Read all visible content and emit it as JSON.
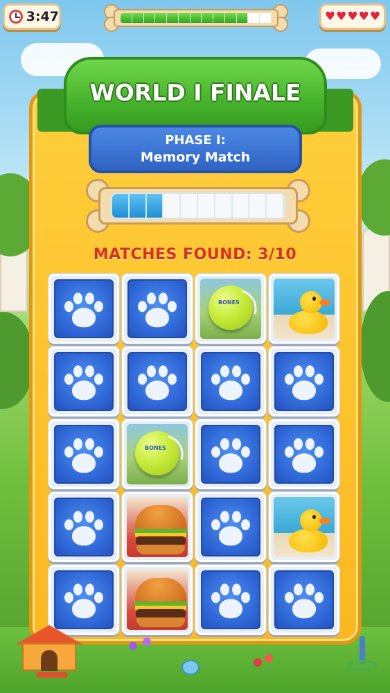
{
  "hud": {
    "timer": "3:47",
    "timer_icon": "alarm-clock-icon",
    "level_progress_fraction": 0.85,
    "level_progress_segments": 13,
    "lives": [
      "♥",
      "♥",
      "♥",
      "♥",
      "♥"
    ],
    "lives_icon": "heart-icon"
  },
  "banner": {
    "title": "WORLD I FINALE"
  },
  "phase": {
    "line1": "PHASE I:",
    "line2": "Memory Match"
  },
  "match_progress": {
    "filled_segments": 3,
    "total_segments": 10
  },
  "matches_label": "MATCHES FOUND: 3/10",
  "board": {
    "columns": 4,
    "rows": 5,
    "cards": [
      "hidden",
      "hidden",
      "tennis-ball",
      "rubber-duck",
      "hidden",
      "hidden",
      "hidden",
      "hidden",
      "hidden",
      "tennis-ball",
      "hidden",
      "hidden",
      "hidden",
      "burger",
      "hidden",
      "rubber-duck",
      "hidden",
      "burger",
      "hidden",
      "hidden"
    ],
    "card_back_icon": "paw-icon",
    "tennis_ball_label": "BONES"
  },
  "colors": {
    "panel": "#fbb820",
    "ribbon": "#45b22b",
    "phase_box": "#2f63c4",
    "matches_text": "#d6331f",
    "card_back": "#2d64d4",
    "progress_fill": "#1f8fd5"
  }
}
